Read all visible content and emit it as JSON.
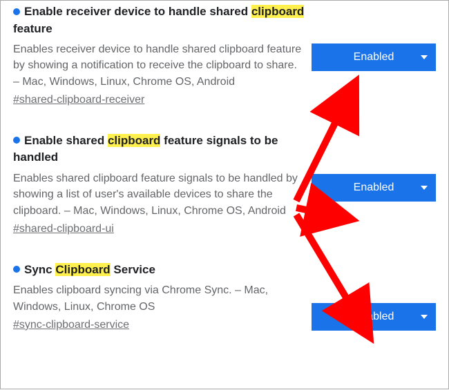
{
  "highlight_term": "clipboard",
  "select_value": "Enabled",
  "flags": [
    {
      "title_pre": "Enable receiver device to handle shared ",
      "title_hl": "clipboard",
      "title_post": " feature",
      "desc": "Enables receiver device to handle shared clipboard feature by showing a notification to receive the clipboard to share. – Mac, Windows, Linux, Chrome OS, Android",
      "anchor": "#shared-clipboard-receiver"
    },
    {
      "title_pre": "Enable shared ",
      "title_hl": "clipboard",
      "title_post": " feature signals to be handled",
      "desc": "Enables shared clipboard feature signals to be handled by showing a list of user's available devices to share the clipboard. – Mac, Windows, Linux, Chrome OS, Android",
      "anchor": "#shared-clipboard-ui"
    },
    {
      "title_pre": "Sync ",
      "title_hl": "Clipboard",
      "title_post": " Service",
      "desc": "Enables clipboard syncing via Chrome Sync. – Mac, Windows, Linux, Chrome OS",
      "anchor": "#sync-clipboard-service"
    }
  ]
}
